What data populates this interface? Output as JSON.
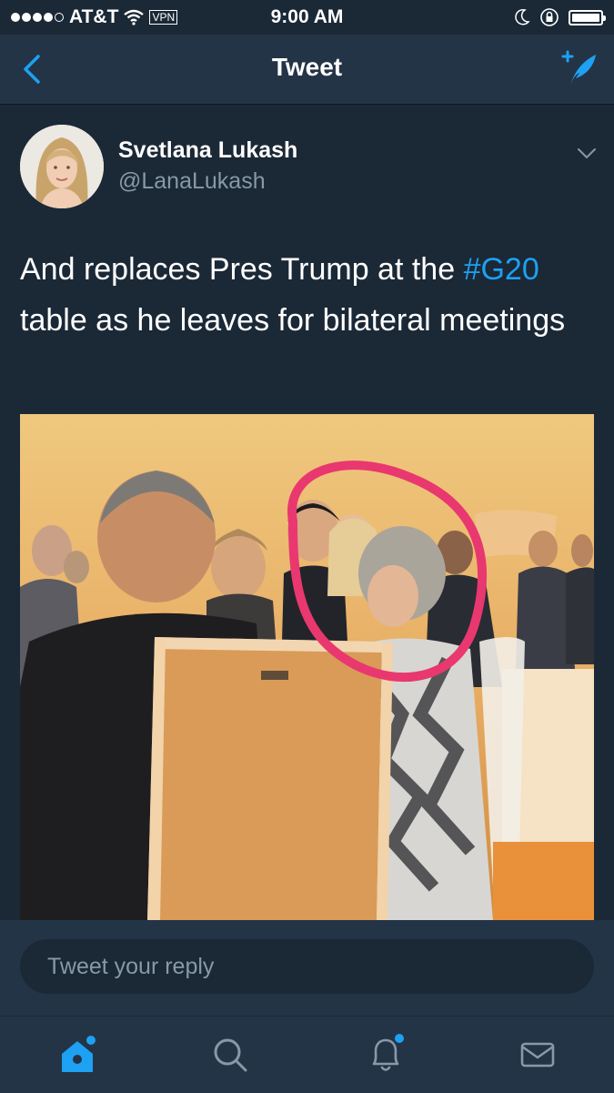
{
  "status_bar": {
    "carrier": "AT&T",
    "vpn_label": "VPN",
    "time": "9:00 AM",
    "icons": [
      "wifi-icon",
      "moon-icon",
      "orientation-lock-icon",
      "battery-icon"
    ]
  },
  "nav": {
    "title": "Tweet",
    "back_icon": "chevron-left-icon",
    "compose_icon": "compose-feather-icon"
  },
  "tweet": {
    "user_name": "Svetlana Lukash",
    "handle": "@LanaLukash",
    "text_before": "And replaces Pres Trump at the ",
    "hashtag": "#G20",
    "text_after": " table as he leaves for bilateral meetings",
    "photo_alt": "Photo from G20 meeting table with a pink circle drawn around two people",
    "menu_icon": "chevron-down-icon"
  },
  "reply": {
    "placeholder": "Tweet your reply"
  },
  "tabs": [
    {
      "name": "home",
      "icon": "home-icon",
      "active": true
    },
    {
      "name": "search",
      "icon": "search-icon",
      "active": false
    },
    {
      "name": "notifications",
      "icon": "bell-icon",
      "active": false
    },
    {
      "name": "messages",
      "icon": "envelope-icon",
      "active": false
    }
  ],
  "colors": {
    "background": "#1b2836",
    "bar": "#243447",
    "accent": "#1da1f2",
    "secondary_text": "#8899a6",
    "circle_annotation": "#e8386f"
  }
}
